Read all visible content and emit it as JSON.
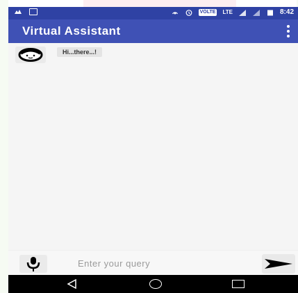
{
  "statusbar": {
    "time": "8:42",
    "volte": "VOLTE",
    "lte": "LTE",
    "icons": [
      "notification-icon",
      "screen-icon",
      "hotspot-icon",
      "alarm-icon",
      "signal-icon",
      "battery-icon"
    ]
  },
  "appbar": {
    "title": "Virtual Assistant",
    "overflow_icon": "more-vert-icon"
  },
  "chat": {
    "messages": [
      {
        "sender": "bot",
        "text": "Hi...there...!"
      }
    ]
  },
  "input": {
    "placeholder": "Enter your query",
    "mic_icon": "microphone-icon",
    "send_icon": "send-icon"
  },
  "colors": {
    "statusbar": "#2f42a4",
    "appbar": "#3f51b5",
    "chat_bg": "#f5f5f5",
    "navbar": "#000000"
  }
}
